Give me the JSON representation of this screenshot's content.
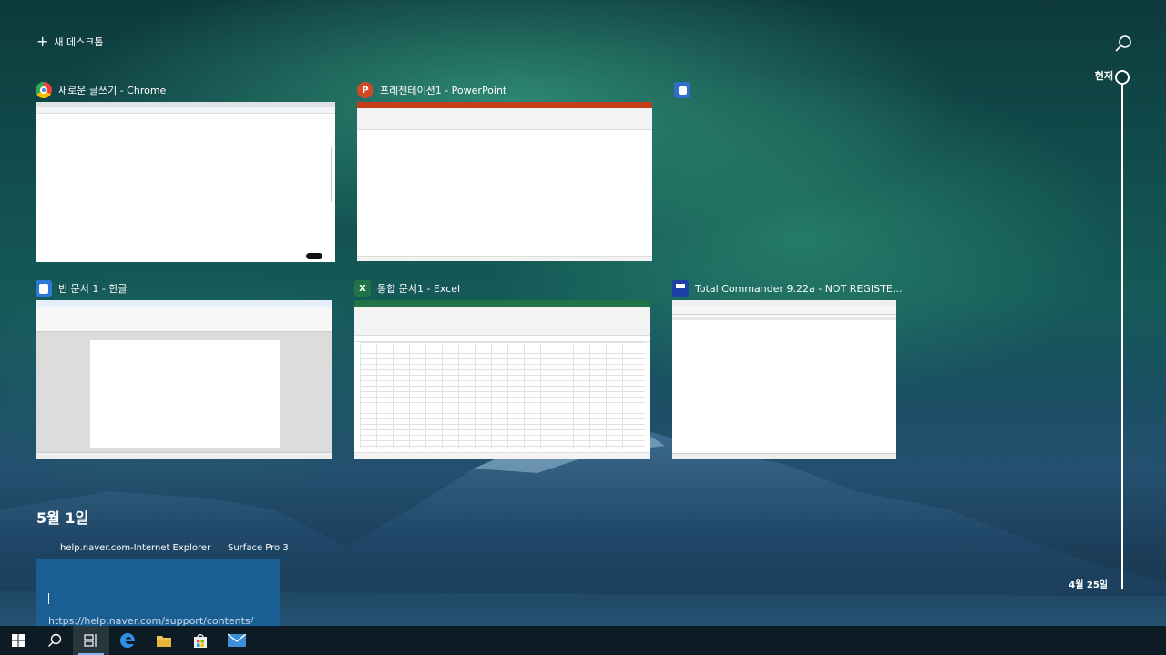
{
  "header": {
    "new_desktop_label": "새 데스크톱",
    "search_icon": "search-icon"
  },
  "timeline": {
    "now_label": "현재",
    "bottom_date": "4월 25일"
  },
  "windows": [
    {
      "title": "새로운 글쓰기 - Chrome",
      "icon": "chrome-icon",
      "accent": "#4285f4"
    },
    {
      "title": "프레젠테이션1 - PowerPoint",
      "icon": "powerpoint-icon",
      "accent": "#d24726",
      "icon_letter": "P"
    },
    {
      "title": "",
      "icon": "app-icon",
      "accent": "#2f6fc9"
    },
    {
      "title": "빈 문서 1 - 한글",
      "icon": "hangul-icon",
      "accent": "#2b7bd6"
    },
    {
      "title": "통합 문서1 - Excel",
      "icon": "excel-icon",
      "accent": "#217346",
      "icon_letter": "X"
    },
    {
      "title": "Total Commander 9.22a - NOT REGISTE...",
      "icon": "floppy-disk-icon",
      "accent": "#1f3fa8"
    }
  ],
  "history": {
    "date_header": "5월 1일",
    "items": [
      {
        "label": "help.naver.com-Internet Explorer",
        "url": "https://help.naver.com/support/contents/"
      },
      {
        "label": "Surface Pro 3"
      }
    ]
  },
  "taskbar": {
    "buttons": [
      "windows-start-icon",
      "search-icon",
      "task-view-icon",
      "edge-icon",
      "file-explorer-icon",
      "store-icon",
      "mail-icon"
    ]
  }
}
